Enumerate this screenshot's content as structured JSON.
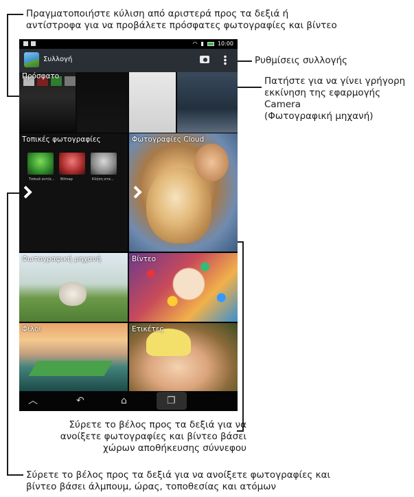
{
  "callouts": {
    "top": {
      "line1": "Πραγματοποιήστε κύλιση από αριστερά προς τα δεξιά ή",
      "line2": "αντίστροφα για να προβάλετε πρόσφατες φωτογραφίες και βίντεο"
    },
    "settings": "Ρυθμίσεις συλλογής",
    "camera": {
      "line1": "Πατήστε για να γίνει γρήγορη",
      "line2": "εκκίνηση της εφαρμογής Camera",
      "line3": "(Φωτογραφική μηχανή)"
    },
    "cloud_arrow": {
      "line1": "Σύρετε το βέλος προς τα δεξιά για να",
      "line2": "ανοίξετε φωτογραφίες και βίντεο βάσει",
      "line3": "χώρων αποθήκευσης σύννεφου"
    },
    "local_arrow": {
      "line1": "Σύρετε το βέλος προς τα δεξιά για να ανοίξετε φωτογραφίες και",
      "line2": "βίντεο βάσει άλμπουμ, ώρας, τοποθεσίας και ατόμων"
    }
  },
  "screen": {
    "status_time": "10:00",
    "app_title": "Συλλογή",
    "tiles": {
      "recent": "Πρόσφατο",
      "local": "Τοπικές φωτογραφίες",
      "cloud": "Φωτογραφίες Cloud",
      "camera": "Φωτογραφική μηχανή",
      "video": "Βίντεο",
      "friends": "Φίλοι",
      "tags": "Ετικέτες"
    },
    "local_thumb_captions": [
      "Τοπικά αντ/α...",
      "Bitmap",
      "Κλήση ατα..."
    ]
  },
  "colors": {
    "action_bar": "#2a2f36",
    "callout_text": "#1a1a1a"
  },
  "icons": [
    "gallery-app-icon",
    "camera-icon",
    "overflow-menu-icon",
    "chevron-right-icon",
    "home-icon",
    "back-icon",
    "recent-apps-icon",
    "up-icon"
  ]
}
